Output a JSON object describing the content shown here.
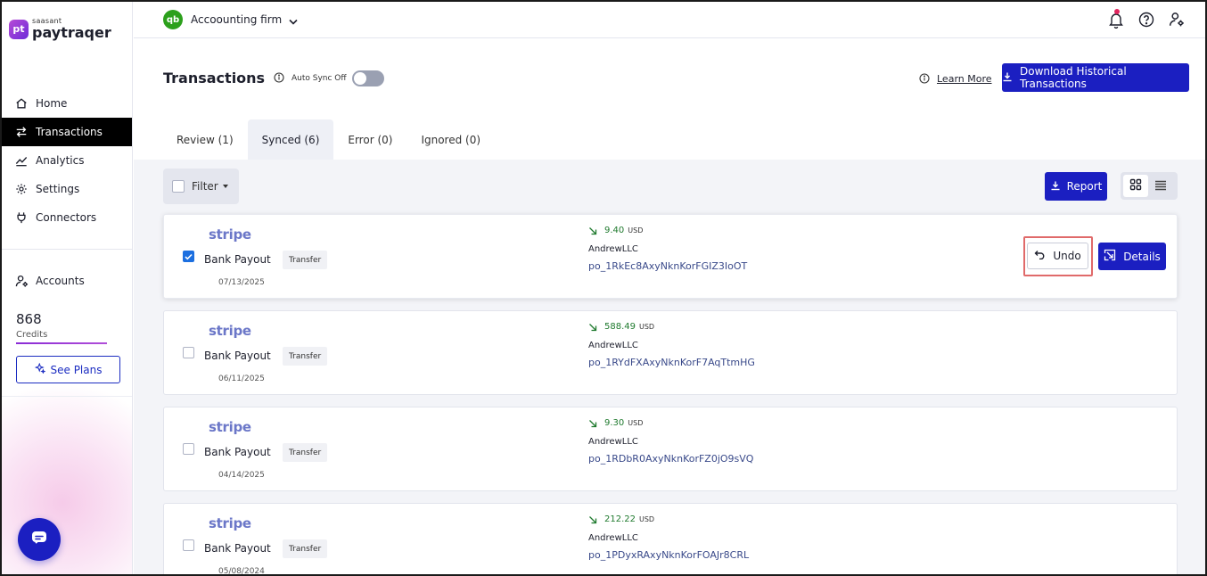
{
  "brand": {
    "badge": "pt",
    "small": "saasant",
    "name": "paytraqer"
  },
  "nav": [
    {
      "label": "Home",
      "icon": "home-icon"
    },
    {
      "label": "Transactions",
      "icon": "transfer-arrows-icon",
      "active": true
    },
    {
      "label": "Analytics",
      "icon": "analytics-icon"
    },
    {
      "label": "Settings",
      "icon": "gear-icon"
    },
    {
      "label": "Connectors",
      "icon": "plug-icon"
    }
  ],
  "accounts": {
    "label": "Accounts",
    "icon": "user-settings-icon"
  },
  "credits": {
    "value": "868",
    "label": "Credits"
  },
  "see_plans": "See Plans",
  "topbar": {
    "qb_badge": "qb",
    "company": "Accoounting firm"
  },
  "header": {
    "title": "Transactions",
    "auto_sync_label": "Auto Sync Off",
    "auto_sync_on": false,
    "learn_more": "Learn More",
    "download_button": "Download Historical Transactions"
  },
  "tabs": [
    {
      "label": "Review (1)",
      "active": false
    },
    {
      "label": "Synced (6)",
      "active": true
    },
    {
      "label": "Error (0)",
      "active": false
    },
    {
      "label": "Ignored (0)",
      "active": false
    }
  ],
  "toolbar": {
    "filter_label": "Filter",
    "report_button": "Report"
  },
  "transactions": [
    {
      "source": "stripe",
      "title": "Bank Payout",
      "type": "Transfer",
      "date": "07/13/2025",
      "amount": "9.40",
      "currency": "USD",
      "customer": "AndrewLLC",
      "payout_id": "po_1RkEc8AxyNknKorFGIZ3IoOT",
      "selected": true
    },
    {
      "source": "stripe",
      "title": "Bank Payout",
      "type": "Transfer",
      "date": "06/11/2025",
      "amount": "588.49",
      "currency": "USD",
      "customer": "AndrewLLC",
      "payout_id": "po_1RYdFXAxyNknKorF7AqTtmHG",
      "selected": false
    },
    {
      "source": "stripe",
      "title": "Bank Payout",
      "type": "Transfer",
      "date": "04/14/2025",
      "amount": "9.30",
      "currency": "USD",
      "customer": "AndrewLLC",
      "payout_id": "po_1RDbR0AxyNknKorFZ0jO9sVQ",
      "selected": false
    },
    {
      "source": "stripe",
      "title": "Bank Payout",
      "type": "Transfer",
      "date": "05/08/2024",
      "amount": "212.22",
      "currency": "USD",
      "customer": "AndrewLLC",
      "payout_id": "po_1PDyxRAxyNknKorFOAJr8CRL",
      "selected": false
    }
  ],
  "actions": {
    "undo": "Undo",
    "details": "Details"
  },
  "colors": {
    "primary": "#1b1fc1",
    "active_nav": "#000000",
    "amount_green": "#1f7a2e",
    "stripe_purple": "#6b77c8",
    "highlight_red": "#e06a6a"
  }
}
